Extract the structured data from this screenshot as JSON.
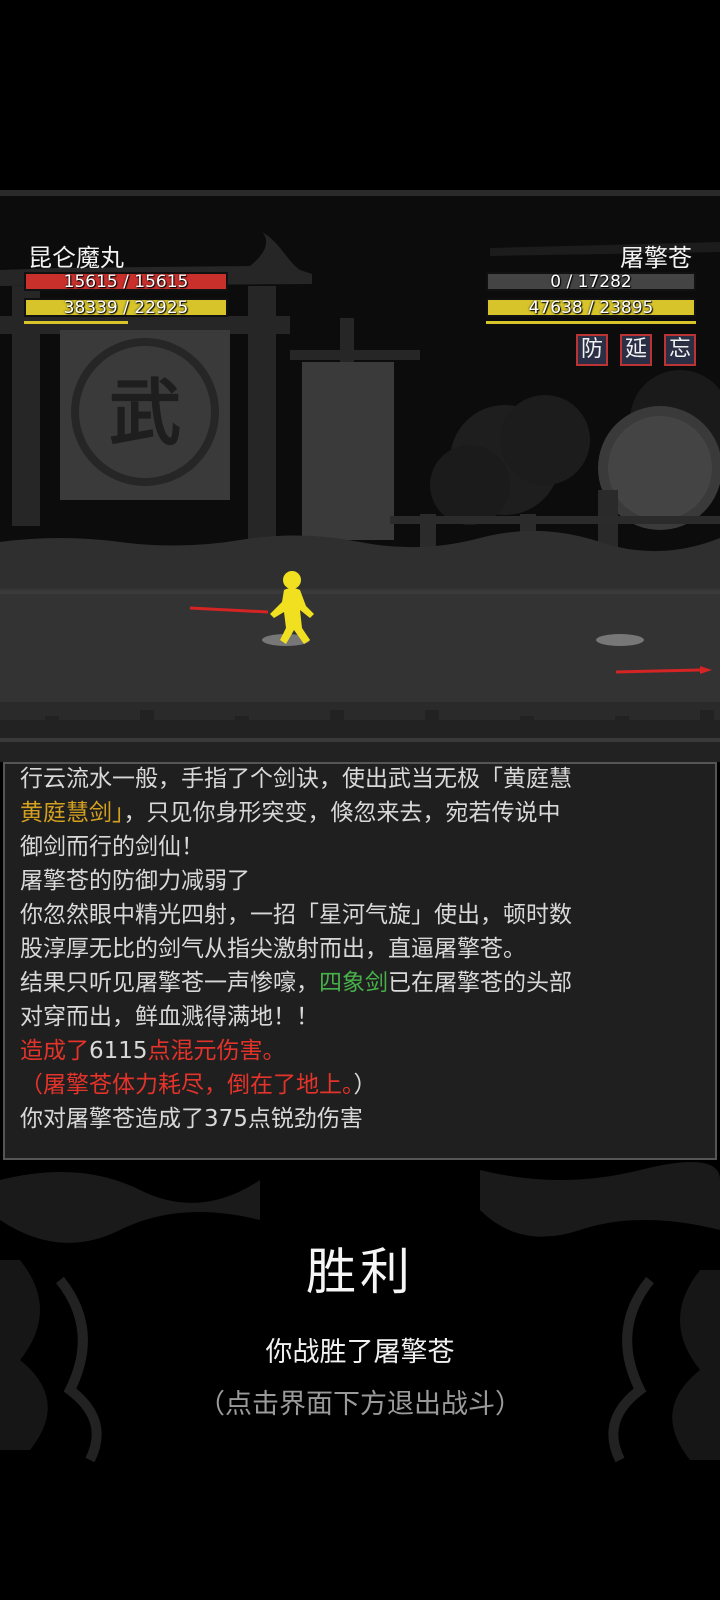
{
  "player": {
    "name": "昆仑魔丸",
    "hp_text": "15615 / 15615",
    "hp_fraction": 1.0,
    "mp_text": "38339 / 22925",
    "mp_fraction": 1.0,
    "hp_color": "#c9302c",
    "mp_color": "#d6c42a"
  },
  "enemy": {
    "name": "屠擎苍",
    "hp_text": "0 / 17282",
    "hp_fraction": 0.0,
    "mp_text": "47638 / 23895",
    "mp_fraction": 1.0,
    "hp_color": "#c9302c",
    "mp_color": "#d6c42a",
    "status_effects": [
      "防",
      "延",
      "忘"
    ]
  },
  "scene": {
    "banner_char": "武",
    "player_color": "#f0e020",
    "spear_color": "#d42424"
  },
  "log": {
    "cut_line": "行云流水一般，手指了个剑诀，使出武当无极「黄庭慧",
    "lines": [
      [
        {
          "t": "黄庭慧剑」",
          "c": "gold"
        },
        {
          "t": "，只见你身形突变，倏忽来去，宛若传说中",
          "c": ""
        }
      ],
      [
        {
          "t": "御剑而行的剑仙！",
          "c": ""
        }
      ],
      [
        {
          "t": "屠擎苍的防御力减弱了",
          "c": ""
        }
      ],
      [
        {
          "t": "你忽然眼中精光四射，一招「星河气旋」使出，顿时数",
          "c": ""
        }
      ],
      [
        {
          "t": "股淳厚无比的剑气从指尖激射而出，直逼屠擎苍。",
          "c": ""
        }
      ],
      [
        {
          "t": "结果只听见屠擎苍一声惨嚎，",
          "c": ""
        },
        {
          "t": "四象剑",
          "c": "green"
        },
        {
          "t": "已在屠擎苍的头部",
          "c": ""
        }
      ],
      [
        {
          "t": "对穿而出，鲜血溅得满地！！",
          "c": ""
        }
      ],
      [
        {
          "t": "造成了",
          "c": "red"
        },
        {
          "t": "6115",
          "c": ""
        },
        {
          "t": "点混元伤害。",
          "c": "red"
        }
      ],
      [
        {
          "t": "（",
          "c": "red"
        },
        {
          "t": "屠擎苍体力耗尽，倒在了地上。",
          "c": "red"
        },
        {
          "t": "）",
          "c": ""
        }
      ],
      [
        {
          "t": "你对屠擎苍造成了375点锐劲伤害",
          "c": ""
        }
      ]
    ]
  },
  "result": {
    "title": "胜利",
    "message": "你战胜了屠擎苍",
    "hint": "（点击界面下方退出战斗）"
  }
}
